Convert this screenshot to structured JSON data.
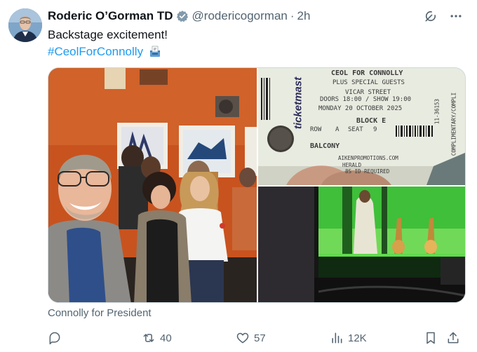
{
  "tweet": {
    "display_name": "Roderic O’Gorman TD",
    "handle": "@rodericogorman",
    "separator": "·",
    "time": "2h",
    "text_line1": "Backstage excitement!",
    "hashtag": "#CeolForConnolly",
    "hashtag_emoji": "ballot-box-icon",
    "card_caption": "Connolly for President"
  },
  "ticket": {
    "brand": "ticketmast",
    "event": "CEOL FOR CONNOLLY",
    "guests": "PLUS SPECIAL GUESTS",
    "venue": "VICAR STREET",
    "doors": "DOORS 18:00 / SHOW 19:00",
    "date": "MONDAY 20 OCTOBER 2025",
    "block": "BLOCK E",
    "row_label": "ROW",
    "row_value": "A",
    "seat_label": "SEAT",
    "seat_value": "9",
    "section": "BALCONY",
    "promoter": "AIKENPROMOTIONS.COM",
    "promoter2": "HERALD",
    "id_note": "8S ID REQUIRED",
    "side_code": "11-36153",
    "side_note": "COMPLIMENTARY/COMPLI"
  },
  "actions": {
    "retweets": "40",
    "likes": "57",
    "views": "12K"
  },
  "colors": {
    "accent": "#1d9bf0",
    "muted": "#536471",
    "text": "#0f1419",
    "verified": "#829aab"
  }
}
